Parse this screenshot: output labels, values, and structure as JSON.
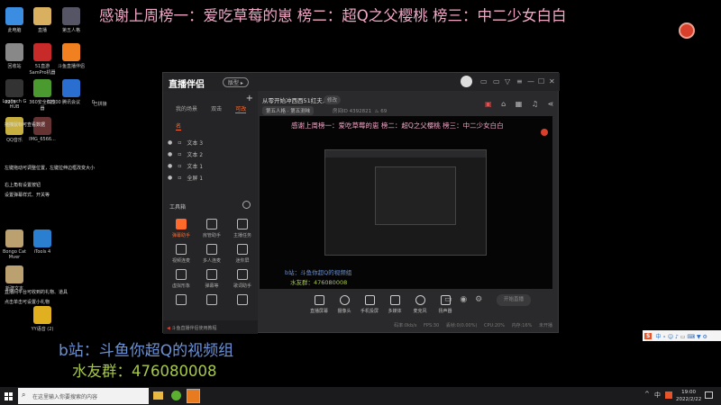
{
  "banner": "感谢上周榜一：爱吃草莓的崽 榜二：超Q之父樱桃 榜三：中二少女白白",
  "desktop_icons": [
    "此电脑",
    "直播",
    "第五人格",
    "回收站",
    "51直游 SamPro机器",
    "斗鱼直播伴侣",
    "Logitech G HUB",
    "360安全浏览器",
    "腾讯会议",
    "已拼接",
    "QQ音乐",
    "IMG_6566...",
    "Bongo Cat Mver",
    "iTools 4",
    "新建文本",
    "YY语音 (2)"
  ],
  "desktop_stats": [
    "9205",
    "62500",
    "0"
  ],
  "desktop_notes": [
    "拖拽鼠标可查看数据",
    "左键拖动可调整位置，左键拉伸边框改变大小",
    "右上角有设置按钮",
    "设置弹幕样式、开关等",
    "点击单击可设置小礼物",
    "直播间平台可收到的礼物、道具"
  ],
  "app": {
    "logo": "直播伴侣",
    "version": "版型 ▸",
    "window_buttons": [
      "▭",
      "▭",
      "▽",
      "≡",
      "—",
      "☐",
      "✕"
    ],
    "left_tabs": [
      "我的场景",
      "双击",
      "可改名"
    ],
    "add": "+",
    "scenes": [
      "文本 3",
      "文本 2",
      "文本 1",
      "全屏 1"
    ],
    "toolbox_title": "工具箱",
    "tools": [
      "弹幕助手",
      "房管助手",
      "主播任务",
      "视频连麦",
      "多人连麦",
      "迷你屏",
      "虚拟形象",
      "弹幕等",
      "歌词助手",
      "",
      "",
      ""
    ],
    "notice": "斗鱼直播伴侣使用教程",
    "room_title": "从零开始冲西西51红夫人",
    "edit": "修改",
    "category": "第五人格 · 第五测味",
    "room_id_label": "房间ID",
    "room_id": "4392821",
    "heat": "69",
    "preview_banner": "感谢上周榜一：爱吃草莓的崽 榜二：超Q之父樱桃 榜三：中二少女白白",
    "preview_b": "b站：斗鱼你超Q的视频组",
    "preview_qq": "水友群：476080008",
    "controls": [
      "直播屏幕",
      "摄像头",
      "手机投屏",
      "多媒体",
      "麦克风",
      "扬声器"
    ],
    "start": "开始直播",
    "status": [
      "码率:0kb/s",
      "FPS:30",
      "丢帧:0(0.00%)",
      "CPU:20%",
      "内存:16%",
      "未开播"
    ]
  },
  "overlay": {
    "b": "b站：斗鱼你超Q的视频组",
    "qq": "水友群：476080008"
  },
  "taskbar": {
    "search": "在这里输入你要搜索的内容",
    "ime": "中",
    "time": "19:00",
    "date": "2022/2/22"
  },
  "colors": {
    "banner": "#f2a6c6",
    "accent": "#ff6a2b",
    "b": "#6b92d6",
    "qq": "#a6c84a"
  }
}
